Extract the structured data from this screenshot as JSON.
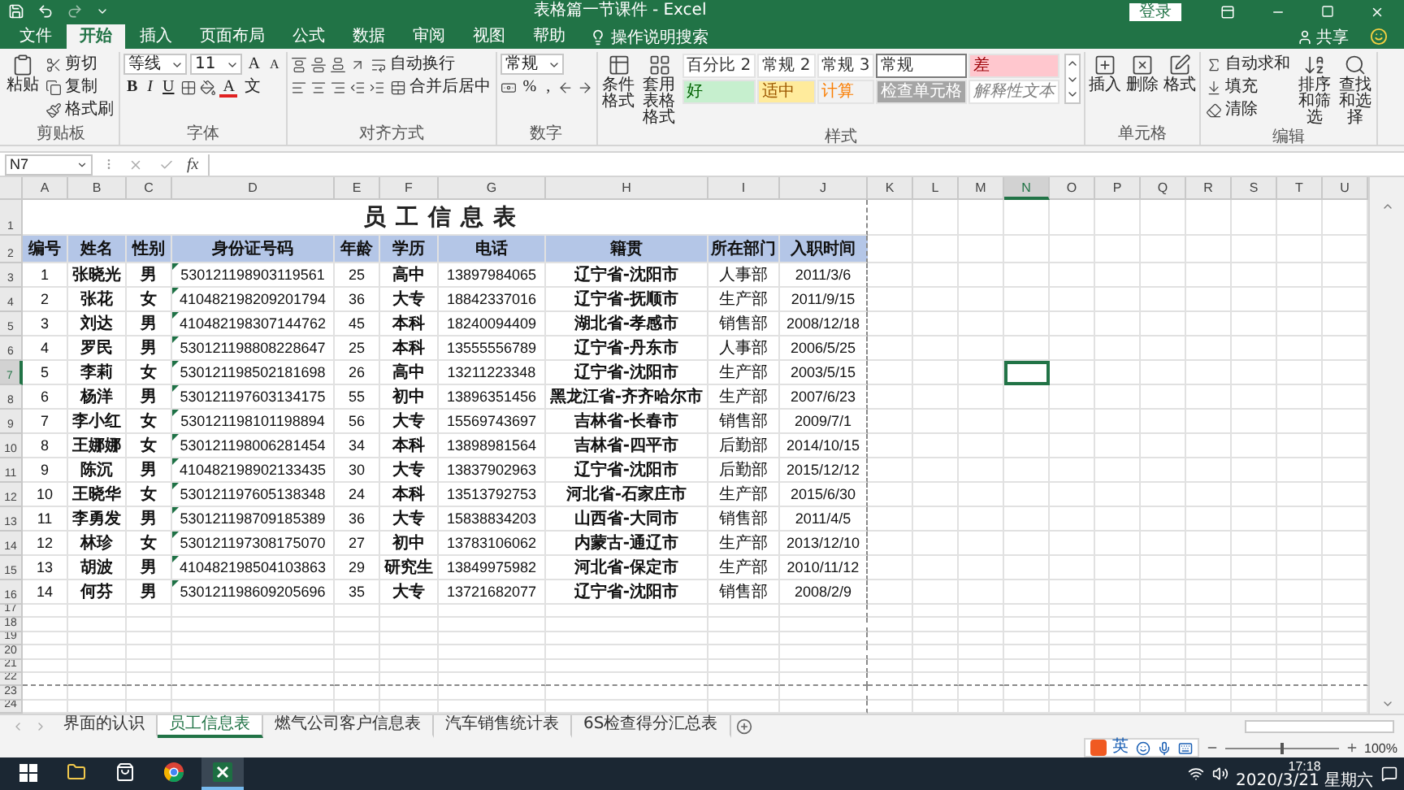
{
  "window": {
    "title": "表格篇一节课件  -  Excel",
    "sign_in": "登录"
  },
  "ribbon_tabs": [
    {
      "label": "文件",
      "selected": false
    },
    {
      "label": "开始",
      "selected": true
    },
    {
      "label": "插入",
      "selected": false
    },
    {
      "label": "页面布局",
      "selected": false
    },
    {
      "label": "公式",
      "selected": false
    },
    {
      "label": "数据",
      "selected": false
    },
    {
      "label": "审阅",
      "selected": false
    },
    {
      "label": "视图",
      "selected": false
    },
    {
      "label": "帮助",
      "selected": false
    }
  ],
  "tell_me": "操作说明搜索",
  "share": "共享",
  "ribbon_groups": [
    {
      "label": "剪贴板",
      "parts": [
        {
          "kind": "big",
          "label": "粘贴"
        },
        {
          "kind": "stack",
          "lines": [
            {
              "items": [
                {
                  "kind": "small",
                  "label": "剪切"
                }
              ]
            },
            {
              "items": [
                {
                  "kind": "small",
                  "label": "复制"
                }
              ]
            },
            {
              "items": [
                {
                  "kind": "small",
                  "label": "格式刷"
                }
              ]
            }
          ]
        }
      ]
    },
    {
      "label": "字体",
      "parts": [
        {
          "kind": "stack",
          "lines": [
            {
              "items": [
                {
                  "kind": "field",
                  "value": "等线"
                },
                {
                  "kind": "field",
                  "value": "11"
                },
                {
                  "kind": "glyph",
                  "label": "A"
                },
                {
                  "kind": "shrink",
                  "label": "A"
                }
              ]
            },
            {
              "items": [
                {
                  "kind": "bold",
                  "label": "B"
                },
                {
                  "kind": "italic",
                  "label": "I"
                },
                {
                  "kind": "underline",
                  "label": "U"
                },
                {
                  "kind": "icon"
                },
                {
                  "kind": "icon"
                },
                {
                  "kind": "fontcolor",
                  "label": "A"
                },
                {
                  "kind": "glyph",
                  "label": "文"
                }
              ]
            }
          ]
        }
      ]
    },
    {
      "label": "对齐方式",
      "parts": [
        {
          "kind": "stack",
          "lines": [
            {
              "items": [
                {
                  "kind": "icon"
                },
                {
                  "kind": "icon"
                },
                {
                  "kind": "icon"
                },
                {
                  "kind": "icon"
                },
                {
                  "kind": "small",
                  "label": "自动换行"
                }
              ]
            },
            {
              "items": [
                {
                  "kind": "icon"
                },
                {
                  "kind": "icon"
                },
                {
                  "kind": "icon"
                },
                {
                  "kind": "icon"
                },
                {
                  "kind": "icon"
                },
                {
                  "kind": "small",
                  "label": "合并后居中"
                }
              ]
            }
          ]
        }
      ]
    },
    {
      "label": "数字",
      "parts": [
        {
          "kind": "stack",
          "lines": [
            {
              "items": [
                {
                  "kind": "field",
                  "value": "常规"
                }
              ]
            },
            {
              "items": [
                {
                  "kind": "icon"
                },
                {
                  "kind": "glyph",
                  "label": "%"
                },
                {
                  "kind": "glyph",
                  "label": ","
                },
                {
                  "kind": "icon"
                },
                {
                  "kind": "icon"
                }
              ]
            }
          ]
        }
      ]
    },
    {
      "label": "样式",
      "parts": [
        {
          "kind": "big",
          "label": "条件格式"
        },
        {
          "kind": "big",
          "label": "套用表格格式"
        },
        {
          "kind": "gallery",
          "lines": [
            {
              "items": [
                {
                  "label": "百分比 2",
                  "kind": "normal",
                  "color": "#ffffff",
                  "selected": false
                },
                {
                  "label": "常规 2",
                  "kind": "normal",
                  "color": "#ffffff",
                  "selected": false
                },
                {
                  "label": "常规 3",
                  "kind": "normal",
                  "color": "#ffffff",
                  "selected": false
                },
                {
                  "label": "常规",
                  "kind": "normal",
                  "color": "#ffffff",
                  "selected": true
                },
                {
                  "label": "差",
                  "kind": "bad",
                  "color": "#ffc7ce",
                  "selected": false
                }
              ]
            },
            {
              "items": [
                {
                  "label": "好",
                  "kind": "good",
                  "color": "#c6efce",
                  "selected": false
                },
                {
                  "label": "适中",
                  "kind": "neutral",
                  "color": "#ffeb9c",
                  "selected": false
                },
                {
                  "label": "计算",
                  "kind": "calculation",
                  "color": "#f2f2f2",
                  "selected": false
                },
                {
                  "label": "检查单元格",
                  "kind": "check",
                  "color": "#a5a5a5",
                  "selected": false
                },
                {
                  "label": "解释性文本",
                  "kind": "explanatory",
                  "color": "#ffffff",
                  "selected": false
                }
              ]
            }
          ]
        }
      ]
    },
    {
      "label": "单元格",
      "parts": [
        {
          "kind": "big",
          "label": "插入"
        },
        {
          "kind": "big",
          "label": "删除"
        },
        {
          "kind": "big",
          "label": "格式"
        }
      ]
    },
    {
      "label": "编辑",
      "parts": [
        {
          "kind": "stack",
          "lines": [
            {
              "items": [
                {
                  "kind": "small",
                  "label": "自动求和"
                }
              ]
            },
            {
              "items": [
                {
                  "kind": "small",
                  "label": "填充"
                }
              ]
            },
            {
              "items": [
                {
                  "kind": "small",
                  "label": "清除"
                }
              ]
            }
          ]
        },
        {
          "kind": "big",
          "label": "排序和筛选"
        },
        {
          "kind": "big",
          "label": "查找和选择"
        }
      ]
    }
  ],
  "formula_bar": {
    "name_box": "N7",
    "function_label": "fx"
  },
  "sheet": {
    "title": "员工信息表",
    "columns": [
      "编号",
      "姓名",
      "性别",
      "身份证号码",
      "年龄",
      "学历",
      "电话",
      "籍贯",
      "所在部门",
      "入职时间"
    ],
    "rows": [
      {
        "flagged": true,
        "cells": [
          "1",
          "张晓光",
          "男",
          "530121198903119561",
          "25",
          "高中",
          "13897984065",
          "辽宁省-沈阳市",
          "人事部",
          "2011/3/6"
        ]
      },
      {
        "flagged": true,
        "cells": [
          "2",
          "张花",
          "女",
          "410482198209201794",
          "36",
          "大专",
          "18842337016",
          "辽宁省-抚顺市",
          "生产部",
          "2011/9/15"
        ]
      },
      {
        "flagged": true,
        "cells": [
          "3",
          "刘达",
          "男",
          "410482198307144762",
          "45",
          "本科",
          "18240094409",
          "湖北省-孝感市",
          "销售部",
          "2008/12/18"
        ]
      },
      {
        "flagged": true,
        "cells": [
          "4",
          "罗民",
          "男",
          "530121198808228647",
          "25",
          "本科",
          "13555556789",
          "辽宁省-丹东市",
          "人事部",
          "2006/5/25"
        ]
      },
      {
        "flagged": true,
        "cells": [
          "5",
          "李莉",
          "女",
          "530121198502181698",
          "26",
          "高中",
          "13211223348",
          "辽宁省-沈阳市",
          "生产部",
          "2003/5/15"
        ]
      },
      {
        "flagged": true,
        "cells": [
          "6",
          "杨洋",
          "男",
          "530121197603134175",
          "55",
          "初中",
          "13896351456",
          "黑龙江省-齐齐哈尔市",
          "生产部",
          "2007/6/23"
        ]
      },
      {
        "flagged": true,
        "cells": [
          "7",
          "李小红",
          "女",
          "530121198101198894",
          "56",
          "大专",
          "15569743697",
          "吉林省-长春市",
          "销售部",
          "2009/7/1"
        ]
      },
      {
        "flagged": true,
        "cells": [
          "8",
          "王娜娜",
          "女",
          "530121198006281454",
          "34",
          "本科",
          "13898981564",
          "吉林省-四平市",
          "后勤部",
          "2014/10/15"
        ]
      },
      {
        "flagged": true,
        "cells": [
          "9",
          "陈沉",
          "男",
          "410482198902133435",
          "30",
          "大专",
          "13837902963",
          "辽宁省-沈阳市",
          "后勤部",
          "2015/12/12"
        ]
      },
      {
        "flagged": true,
        "cells": [
          "10",
          "王晓华",
          "女",
          "530121197605138348",
          "24",
          "本科",
          "13513792753",
          "河北省-石家庄市",
          "生产部",
          "2015/6/30"
        ]
      },
      {
        "flagged": true,
        "cells": [
          "11",
          "李勇发",
          "男",
          "530121198709185389",
          "36",
          "大专",
          "15838834203",
          "山西省-大同市",
          "销售部",
          "2011/4/5"
        ]
      },
      {
        "flagged": true,
        "cells": [
          "12",
          "林珍",
          "女",
          "530121197308175070",
          "27",
          "初中",
          "13783106062",
          "内蒙古-通辽市",
          "生产部",
          "2013/12/10"
        ]
      },
      {
        "flagged": true,
        "cells": [
          "13",
          "胡波",
          "男",
          "410482198504103863",
          "29",
          "研究生",
          "13849975982",
          "河北省-保定市",
          "生产部",
          "2010/11/12"
        ]
      },
      {
        "flagged": true,
        "cells": [
          "14",
          "何芬",
          "男",
          "530121198609205696",
          "35",
          "大专",
          "13721682077",
          "辽宁省-沈阳市",
          "销售部",
          "2008/2/9"
        ]
      }
    ],
    "column_headers": [
      {
        "label": "A",
        "selected": false
      },
      {
        "label": "B",
        "selected": false
      },
      {
        "label": "C",
        "selected": false
      },
      {
        "label": "D",
        "selected": false
      },
      {
        "label": "E",
        "selected": false
      },
      {
        "label": "F",
        "selected": false
      },
      {
        "label": "G",
        "selected": false
      },
      {
        "label": "H",
        "selected": false
      },
      {
        "label": "I",
        "selected": false
      },
      {
        "label": "J",
        "selected": false
      },
      {
        "label": "K",
        "selected": false
      },
      {
        "label": "L",
        "selected": false
      },
      {
        "label": "M",
        "selected": false
      },
      {
        "label": "N",
        "selected": true
      },
      {
        "label": "O",
        "selected": false
      },
      {
        "label": "P",
        "selected": false
      },
      {
        "label": "Q",
        "selected": false
      },
      {
        "label": "R",
        "selected": false
      },
      {
        "label": "S",
        "selected": false
      },
      {
        "label": "T",
        "selected": false
      },
      {
        "label": "U",
        "selected": false
      }
    ],
    "row_headers": [
      {
        "label": "1",
        "selected": false
      },
      {
        "label": "2",
        "selected": false
      },
      {
        "label": "3",
        "selected": false
      },
      {
        "label": "4",
        "selected": false
      },
      {
        "label": "5",
        "selected": false
      },
      {
        "label": "6",
        "selected": false
      },
      {
        "label": "7",
        "selected": true
      },
      {
        "label": "8",
        "selected": false
      },
      {
        "label": "9",
        "selected": false
      },
      {
        "label": "10",
        "selected": false
      },
      {
        "label": "11",
        "selected": false
      },
      {
        "label": "12",
        "selected": false
      },
      {
        "label": "13",
        "selected": false
      },
      {
        "label": "14",
        "selected": false
      },
      {
        "label": "15",
        "selected": false
      },
      {
        "label": "16",
        "selected": false
      },
      {
        "label": "17",
        "selected": false
      },
      {
        "label": "18",
        "selected": false
      },
      {
        "label": "19",
        "selected": false
      },
      {
        "label": "20",
        "selected": false
      },
      {
        "label": "21",
        "selected": false
      },
      {
        "label": "22",
        "selected": false
      },
      {
        "label": "23",
        "selected": false
      },
      {
        "label": "24",
        "selected": false
      }
    ]
  },
  "sheet_tabs": [
    {
      "label": "界面的认识",
      "selected": false
    },
    {
      "label": "员工信息表",
      "selected": true
    },
    {
      "label": "燃气公司客户信息表",
      "selected": false
    },
    {
      "label": "汽车销售统计表",
      "selected": false
    },
    {
      "label": "6S检查得分汇总表",
      "selected": false
    }
  ],
  "status_bar": {
    "ime_language": "英",
    "zoom_slider": {
      "level": 0.5
    },
    "zoom": "100%"
  },
  "taskbar": {
    "time": "17:18",
    "date": "2020/3/21 星期六"
  }
}
